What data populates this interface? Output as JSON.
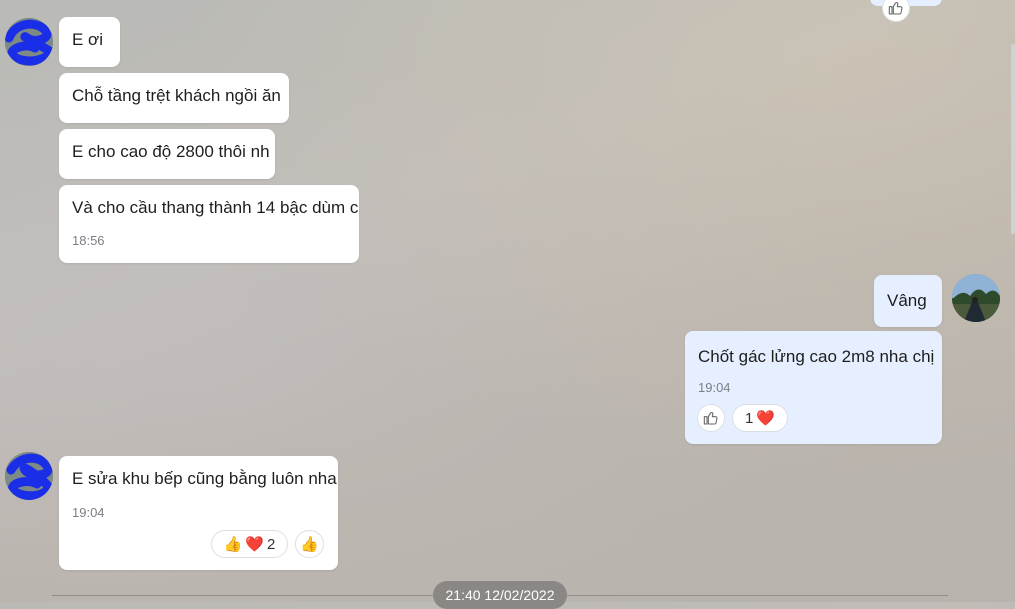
{
  "messages": {
    "m1": {
      "text": "E ơi"
    },
    "m2": {
      "text": "Chỗ tầng trệt khách ngồi ăn"
    },
    "m3": {
      "text": "E cho cao độ 2800 thôi nh"
    },
    "m4": {
      "text": "Và cho cầu thang thành 14 bậc dùm c",
      "time": "18:56"
    },
    "m5": {
      "text": "Vâng"
    },
    "m6": {
      "text": "Chốt gác lửng cao 2m8 nha chị",
      "time": "19:04",
      "reaction_count": "1",
      "reaction_emoji": "❤️"
    },
    "m7": {
      "text": "E sửa khu bếp cũng bằng luôn nha",
      "time": "19:04",
      "reaction_count": "2",
      "reaction_emoji_1": "👍",
      "reaction_emoji_2": "❤️",
      "quick_like": "👍"
    }
  },
  "date_divider": "21:40 12/02/2022",
  "colors": {
    "incoming_bubble": "#ffffff",
    "outgoing_bubble": "#e5efff",
    "stamp_bg": "#8b8784"
  },
  "icons": [
    "like-outline-icon",
    "heart-icon",
    "thumbs-up-icon"
  ]
}
